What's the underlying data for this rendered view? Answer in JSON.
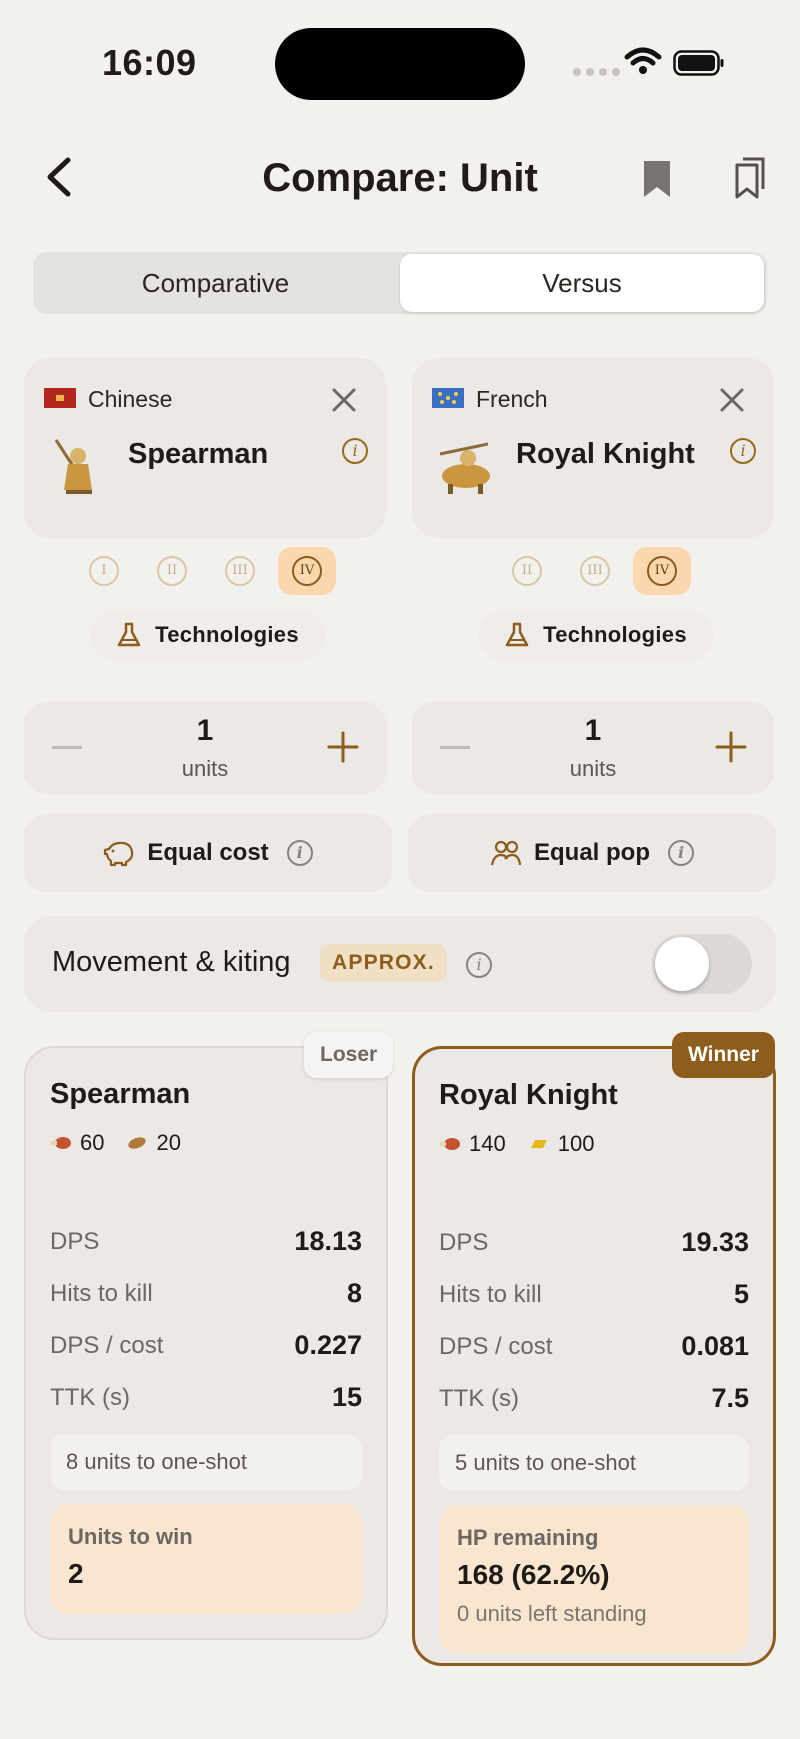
{
  "status": {
    "time": "16:09"
  },
  "header": {
    "title": "Compare: Unit"
  },
  "tabs": [
    {
      "label": "Comparative",
      "active": false
    },
    {
      "label": "Versus",
      "active": true
    }
  ],
  "left": {
    "civ": "Chinese",
    "unit": "Spearman",
    "ages": [
      "I",
      "II",
      "III",
      "IV"
    ],
    "selected_age": "IV",
    "technologies": "Technologies",
    "count": "1",
    "count_label": "units",
    "equal": "Equal cost"
  },
  "right": {
    "civ": "French",
    "unit": "Royal Knight",
    "ages": [
      "II",
      "III",
      "IV"
    ],
    "selected_age": "IV",
    "technologies": "Technologies",
    "count": "1",
    "count_label": "units",
    "equal": "Equal pop"
  },
  "movement": {
    "label": "Movement & kiting",
    "badge": "APPROX.",
    "enabled": false
  },
  "results": {
    "left": {
      "badge": "Loser",
      "name": "Spearman",
      "food": "60",
      "wood": "20",
      "stats": [
        {
          "k": "DPS",
          "v": "18.13"
        },
        {
          "k": "Hits to kill",
          "v": "8"
        },
        {
          "k": "DPS / cost",
          "v": "0.227"
        },
        {
          "k": "TTK (s)",
          "v": "15"
        }
      ],
      "note": "8 units to one-shot",
      "result_label": "Units to win",
      "result_value": "2"
    },
    "right": {
      "badge": "Winner",
      "name": "Royal Knight",
      "food": "140",
      "gold": "100",
      "stats": [
        {
          "k": "DPS",
          "v": "19.33"
        },
        {
          "k": "Hits to kill",
          "v": "5"
        },
        {
          "k": "DPS / cost",
          "v": "0.081"
        },
        {
          "k": "TTK (s)",
          "v": "7.5"
        }
      ],
      "note": "5 units to one-shot",
      "result_label": "HP remaining",
      "result_value": "168 (62.2%)",
      "result_sub": "0 units left standing"
    }
  },
  "colors": {
    "accent": "#8c5d1c",
    "selected_age_bg": "#fbd7ad",
    "result_bg": "#f8e6d0"
  }
}
